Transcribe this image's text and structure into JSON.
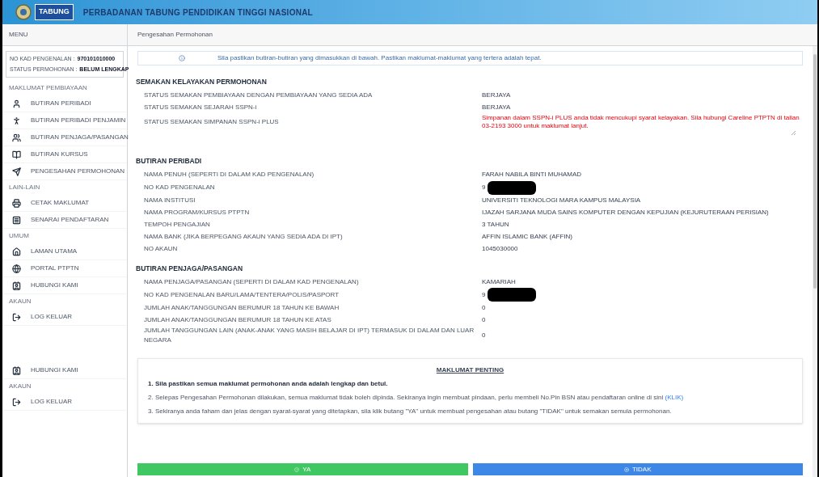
{
  "header": {
    "logo_text": "TABUNG",
    "title": "PERBADANAN TABUNG PENDIDIKAN TINGGI NASIONAL"
  },
  "sidebar": {
    "title": "MENU",
    "info": [
      {
        "label": "NO KAD PENGENALAN :",
        "value": "970101010000"
      },
      {
        "label": "STATUS PERMOHONAN :",
        "value": "BELUM LENGKAP"
      }
    ],
    "sections": [
      {
        "heading": "MAKLUMAT PEMBIAYAAN",
        "items": [
          {
            "label": "BUTIRAN PERIBADI"
          },
          {
            "label": "BUTIRAN PERIBADI PENJAMIN"
          },
          {
            "label": "BUTIRAN PENJAGA/PASANGAN"
          },
          {
            "label": "BUTIRAN KURSUS"
          },
          {
            "label": "PENGESAHAN PERMOHONAN"
          }
        ]
      },
      {
        "heading": "LAIN-LAIN",
        "items": [
          {
            "label": "CETAK MAKLUMAT"
          },
          {
            "label": "SENARAI PENDAFTARAN"
          }
        ]
      },
      {
        "heading": "UMUM",
        "items": [
          {
            "label": "LAMAN UTAMA"
          },
          {
            "label": "PORTAL PTPTN"
          },
          {
            "label": "HUBUNGI KAMI"
          }
        ]
      },
      {
        "heading": "AKAUN",
        "items": [
          {
            "label": "LOG KELUAR"
          }
        ]
      }
    ],
    "extra_sections": [
      {
        "items": [
          {
            "label": "HUBUNGI KAMI"
          }
        ]
      },
      {
        "heading": "AKAUN",
        "items": [
          {
            "label": "LOG KELUAR"
          }
        ]
      }
    ]
  },
  "breadcrumb": "Pengesahan Permohonan",
  "alert": "Sila pastikan butiran-butiran yang dimasukkan di bawah. Pastikan maklumat-maklumat yang tertera adalah tepat.",
  "sections": [
    {
      "heading": "SEMAKAN KELAYAKAN PERMOHONAN",
      "rows": [
        {
          "label": "STATUS SEMAKAN PEMBIAYAAN DENGAN PEMBIAYAAN YANG SEDIA ADA",
          "value": "BERJAYA",
          "kind": "text"
        },
        {
          "label": "STATUS SEMAKAN SEJARAH SSPN-i",
          "value": "BERJAYA",
          "kind": "text"
        },
        {
          "label": "STATUS SEMAKAN SIMPANAN SSPN-i PLUS",
          "value": "Simpanan dalam SSPN-i PLUS anda tidak mencukupi syarat kelayakan. Sila hubungi Careline PTPTN di talian 03-2193 3000 untuk maklumat lanjut.",
          "kind": "error"
        }
      ]
    },
    {
      "heading": "BUTIRAN PERIBADI",
      "rows": [
        {
          "label": "NAMA PENUH (SEPERTI DI DALAM KAD PENGENALAN)",
          "value": "FARAH NABILA BINTI MUHAMAD",
          "kind": "text"
        },
        {
          "label": "NO KAD PENGENALAN",
          "value": "9",
          "kind": "redacted"
        },
        {
          "label": "NAMA INSTITUSI",
          "value": "UNIVERSITI TEKNOLOGI MARA KAMPUS MALAYSIA",
          "kind": "text"
        },
        {
          "label": "NAMA PROGRAM/KURSUS PTPTN",
          "value": "IJAZAH SARJANA MUDA SAINS KOMPUTER DENGAN KEPUJIAN (KEJURUTERAAN PERISIAN)",
          "kind": "text"
        },
        {
          "label": "TEMPOH PENGAJIAN",
          "value": "3 TAHUN",
          "kind": "text"
        },
        {
          "label": "NAMA BANK (JIKA BERPEGANG AKAUN YANG SEDIA ADA DI IPT)",
          "value": "AFFIN ISLAMIC BANK (AFFIN)",
          "kind": "text"
        },
        {
          "label": "NO AKAUN",
          "value": "1045030000",
          "kind": "text"
        }
      ]
    },
    {
      "heading": "BUTIRAN PENJAGA/PASANGAN",
      "rows": [
        {
          "label": "NAMA PENJAGA/PASANGAN (SEPERTI DI DALAM KAD PENGENALAN)",
          "value": "KAMARIAH",
          "kind": "text"
        },
        {
          "label": "NO KAD PENGENALAN BARU/LAMA/TENTERA/POLIS/PASPORT",
          "value": "9",
          "kind": "redacted"
        },
        {
          "label": "JUMLAH ANAK/TANGGUNGAN BERUMUR 18 TAHUN KE BAWAH",
          "value": "0",
          "kind": "text"
        },
        {
          "label": "JUMLAH ANAK/TANGGUNGAN BERUMUR 18 TAHUN KE ATAS",
          "value": "0",
          "kind": "text"
        },
        {
          "label": "JUMLAH TANGGUNGAN LAIN (ANAK-ANAK YANG MASIH BELAJAR DI IPT) TERMASUK DI DALAM DAN LUAR NEGARA",
          "value": "0",
          "kind": "text"
        }
      ]
    }
  ],
  "notice": {
    "title": "MAKLUMAT PENTING",
    "items": [
      {
        "text": "1. Sila pastikan semua maklumat permohonan anda adalah lengkap dan betul.",
        "bold": true
      },
      {
        "text": "2. Selepas Pengesahan Permohonan dilakukan, semua maklumat tidak boleh dipinda. Sekiranya ingin membuat pindaan, perlu membeli No.Pin BSN atau pendaftaran online di sini",
        "link": "(KLIK)",
        "bold": false
      },
      {
        "text": "3. Sekiranya anda faham dan jelas dengan syarat-syarat yang ditetapkan, sila klik butang \"YA\" untuk membuat pengesahan atau butang \"TIDAK\" untuk semakan semula permohonan.",
        "bold": false
      }
    ]
  },
  "buttons": [
    {
      "label": "YA",
      "kind": "confirm"
    },
    {
      "label": "TIDAK",
      "kind": "cancel"
    }
  ]
}
